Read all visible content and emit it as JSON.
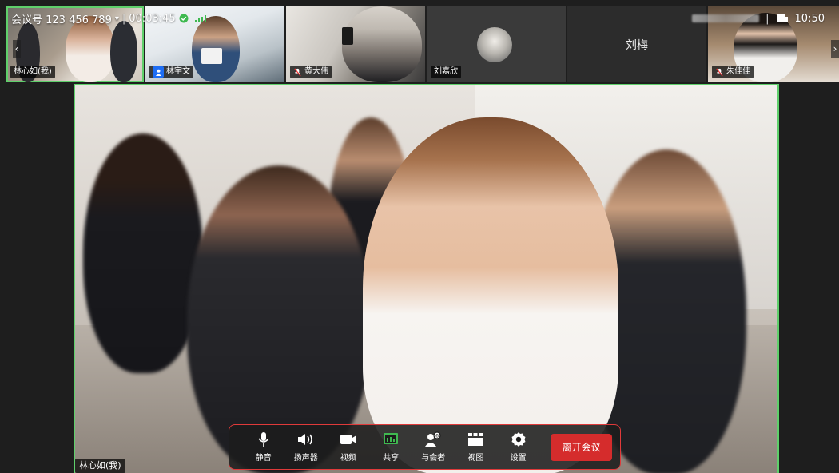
{
  "topbar": {
    "meeting_id_label": "会议号 123 456 789",
    "meeting_dropdown": "▾",
    "separator": "|",
    "elapsed": "00:03:45",
    "clock": "10:50",
    "right_separator": "|"
  },
  "participants": [
    {
      "name": "林心如(我)",
      "muted": false,
      "active": true
    },
    {
      "name": "林宇文",
      "muted": false,
      "badge": "blue"
    },
    {
      "name": "黄大伟",
      "muted": true
    },
    {
      "name": "刘嘉欣",
      "muted": false,
      "avatar_only": true
    },
    {
      "name": "刘梅",
      "muted": false,
      "name_only": true
    },
    {
      "name": "朱佳佳",
      "muted": true
    }
  ],
  "main_video": {
    "name": "林心如(我)"
  },
  "toolbar": {
    "buttons": [
      {
        "label": "静音",
        "icon": "microphone-icon"
      },
      {
        "label": "扬声器",
        "icon": "speaker-icon"
      },
      {
        "label": "视频",
        "icon": "video-camera-icon"
      },
      {
        "label": "共享",
        "icon": "share-screen-icon"
      },
      {
        "label": "与会者",
        "icon": "participants-icon"
      },
      {
        "label": "视图",
        "icon": "view-layout-icon"
      },
      {
        "label": "设置",
        "icon": "settings-gear-icon"
      }
    ],
    "leave_label": "离开会议"
  },
  "colors": {
    "active_border": "#5fcf6b",
    "leave_button": "#d52c2c",
    "toolbar_outline": "#e03a3a",
    "share_icon": "#3fb950",
    "badge_blue": "#1e6ef5"
  }
}
